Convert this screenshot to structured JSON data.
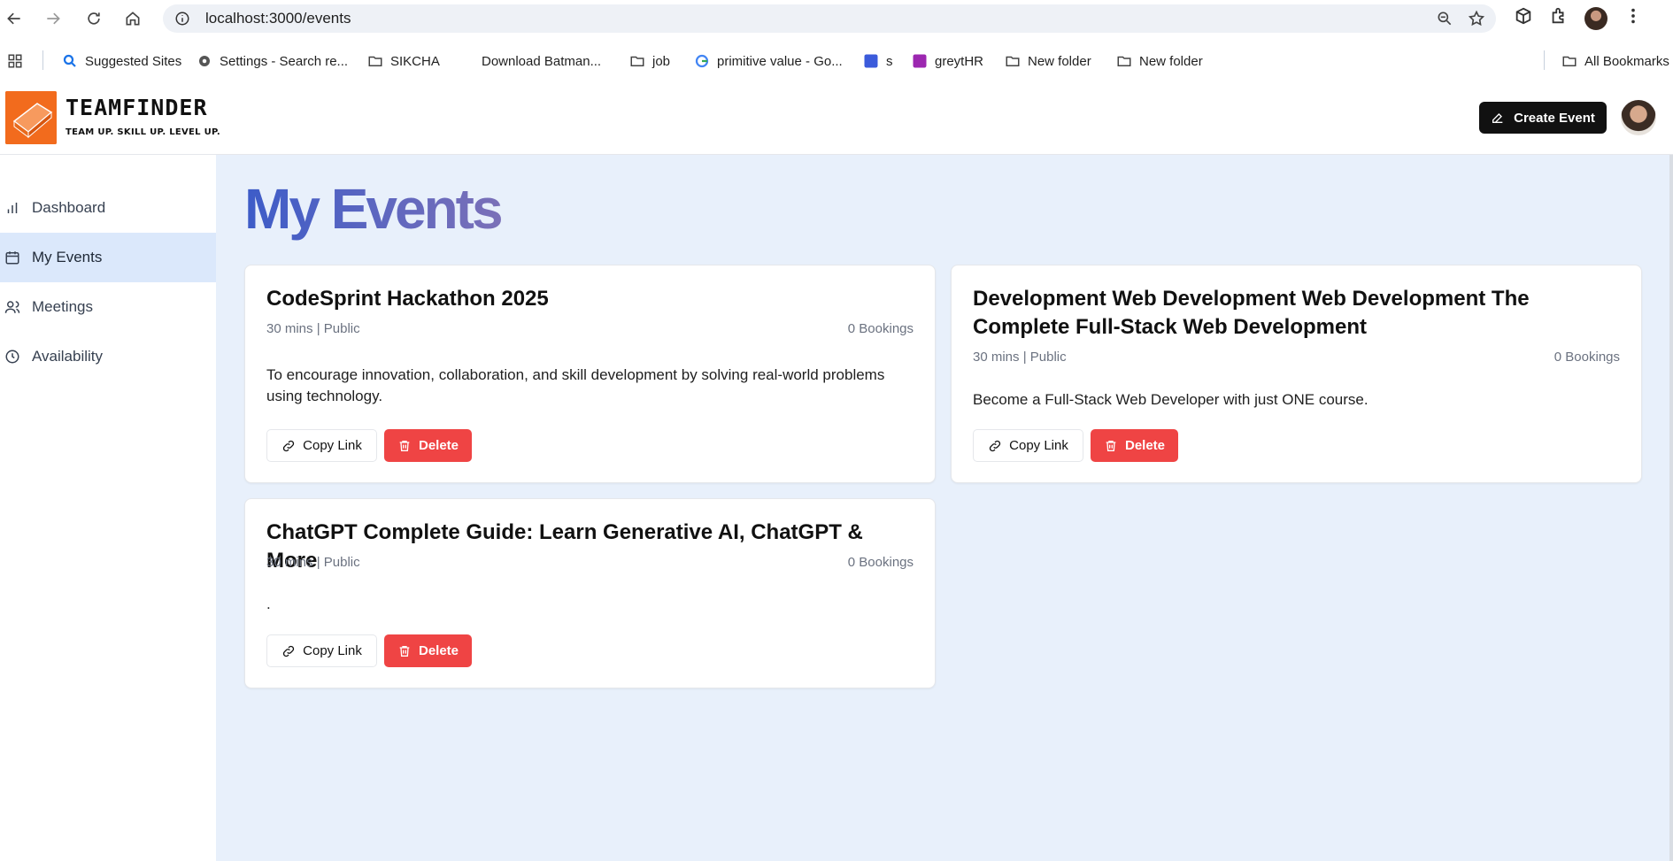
{
  "browser": {
    "url": "localhost:3000/events",
    "bookmarks": [
      {
        "label": "Suggested Sites",
        "icon": "search-icon"
      },
      {
        "label": "Settings - Search re...",
        "icon": "gear-icon"
      },
      {
        "label": "SIKCHA",
        "icon": "folder-icon"
      },
      {
        "label": "Download Batman...",
        "icon": "none"
      },
      {
        "label": "job",
        "icon": "folder-icon"
      },
      {
        "label": "primitive value - Go...",
        "icon": "google-icon"
      },
      {
        "label": "s",
        "icon": "app-icon"
      },
      {
        "label": "greytHR",
        "icon": "greythr-icon"
      },
      {
        "label": "New folder",
        "icon": "folder-icon"
      },
      {
        "label": "New folder",
        "icon": "folder-icon"
      }
    ],
    "all_bookmarks": "All Bookmarks"
  },
  "header": {
    "logo_title": "TEAMFINDER",
    "logo_tagline": "TEAM UP. SKILL UP. LEVEL UP.",
    "create_label": "Create Event"
  },
  "sidebar": {
    "items": [
      {
        "label": "Dashboard",
        "icon": "bar-chart-icon"
      },
      {
        "label": "My Events",
        "icon": "calendar-icon"
      },
      {
        "label": "Meetings",
        "icon": "users-icon"
      },
      {
        "label": "Availability",
        "icon": "clock-icon"
      }
    ]
  },
  "main": {
    "title": "My Events",
    "events": [
      {
        "title": "CodeSprint Hackathon 2025",
        "meta": "30 mins | Public",
        "bookings": "0 Bookings",
        "description": "To encourage innovation, collaboration, and skill development by solving real-world problems using technology.",
        "copy_label": "Copy Link",
        "delete_label": "Delete"
      },
      {
        "title": "Development Web Development Web Development The Complete Full-Stack Web Development",
        "meta": "30 mins | Public",
        "bookings": "0 Bookings",
        "description": "Become a Full-Stack Web Developer with just ONE course.",
        "copy_label": "Copy Link",
        "delete_label": "Delete"
      },
      {
        "title": "ChatGPT Complete Guide: Learn Generative AI, ChatGPT & More",
        "meta": "30 mins | Public",
        "bookings": "0 Bookings",
        "description": ".",
        "copy_label": "Copy Link",
        "delete_label": "Delete"
      }
    ]
  },
  "colors": {
    "brand_orange": "#f26b1d",
    "delete_red": "#ef4444",
    "active_nav": "#dbe8fb",
    "main_bg": "#e8f0fb"
  }
}
